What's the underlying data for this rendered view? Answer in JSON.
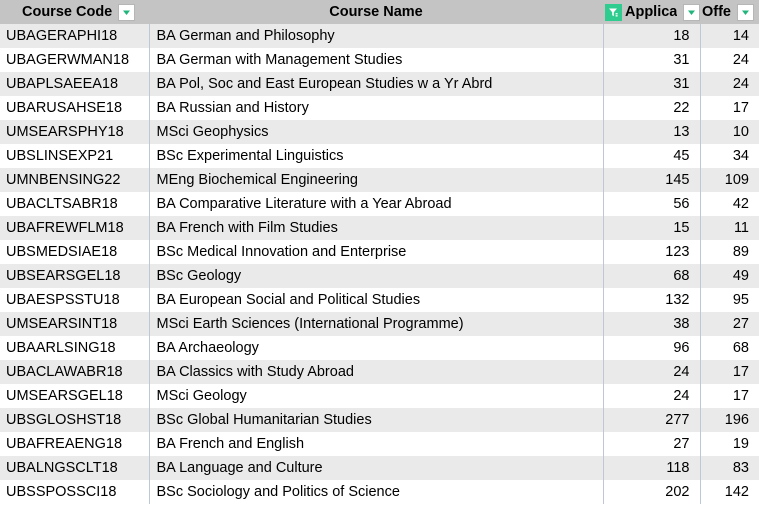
{
  "table": {
    "columns": [
      {
        "label": "Course Code",
        "icon": "chevron-down-icon",
        "filtered": false,
        "align": "left"
      },
      {
        "label": "Course Name",
        "icon": "chevron-down-icon",
        "filtered": false,
        "align": "left"
      },
      {
        "label": "Applicatio",
        "icon": "filter-icon",
        "filtered": true,
        "align": "right"
      },
      {
        "label": "Offe",
        "icon": "chevron-down-icon",
        "filtered": false,
        "align": "right"
      }
    ],
    "rows": [
      {
        "code": "UBAGERAPHI18",
        "name": "BA German and Philosophy",
        "applications": "18",
        "offers": "14"
      },
      {
        "code": "UBAGERWMAN18",
        "name": "BA German with Management Studies",
        "applications": "31",
        "offers": "24"
      },
      {
        "code": "UBAPLSAEEA18",
        "name": "BA Pol, Soc and East European Studies w a Yr Abrd",
        "applications": "31",
        "offers": "24"
      },
      {
        "code": "UBARUSAHSE18",
        "name": "BA Russian and History",
        "applications": "22",
        "offers": "17"
      },
      {
        "code": "UMSEARSPHY18",
        "name": "MSci Geophysics",
        "applications": "13",
        "offers": "10"
      },
      {
        "code": "UBSLINSEXP21",
        "name": "BSc Experimental Linguistics",
        "applications": "45",
        "offers": "34"
      },
      {
        "code": "UMNBENSING22",
        "name": "MEng Biochemical Engineering",
        "applications": "145",
        "offers": "109"
      },
      {
        "code": "UBACLTSABR18",
        "name": "BA Comparative Literature with a Year Abroad",
        "applications": "56",
        "offers": "42"
      },
      {
        "code": "UBAFREWFLM18",
        "name": "BA French with Film Studies",
        "applications": "15",
        "offers": "11"
      },
      {
        "code": "UBSMEDSIAE18",
        "name": "BSc Medical Innovation and Enterprise",
        "applications": "123",
        "offers": "89"
      },
      {
        "code": "UBSEARSGEL18",
        "name": "BSc Geology",
        "applications": "68",
        "offers": "49"
      },
      {
        "code": "UBAESPSSTU18",
        "name": "BA European Social and Political Studies",
        "applications": "132",
        "offers": "95"
      },
      {
        "code": "UMSEARSINT18",
        "name": "MSci Earth Sciences (International Programme)",
        "applications": "38",
        "offers": "27"
      },
      {
        "code": "UBAARLSING18",
        "name": "BA Archaeology",
        "applications": "96",
        "offers": "68"
      },
      {
        "code": "UBACLAWABR18",
        "name": "BA Classics with Study Abroad",
        "applications": "24",
        "offers": "17"
      },
      {
        "code": "UMSEARSGEL18",
        "name": "MSci Geology",
        "applications": "24",
        "offers": "17"
      },
      {
        "code": "UBSGLOSHST18",
        "name": "BSc Global Humanitarian Studies",
        "applications": "277",
        "offers": "196"
      },
      {
        "code": "UBAFREAENG18",
        "name": "BA French and English",
        "applications": "27",
        "offers": "19"
      },
      {
        "code": "UBALNGSCLT18",
        "name": "BA Language and Culture",
        "applications": "118",
        "offers": "83"
      },
      {
        "code": "UBSSPOSSCI18",
        "name": "BSc Sociology and Politics of Science",
        "applications": "202",
        "offers": "142"
      }
    ]
  },
  "colors": {
    "header_bg": "#c4c4c4",
    "banded_row_bg": "#eaeaea",
    "row_bg": "#ffffff",
    "filter_active": "#2ecc8f",
    "gridline": "#bfc6d4"
  }
}
